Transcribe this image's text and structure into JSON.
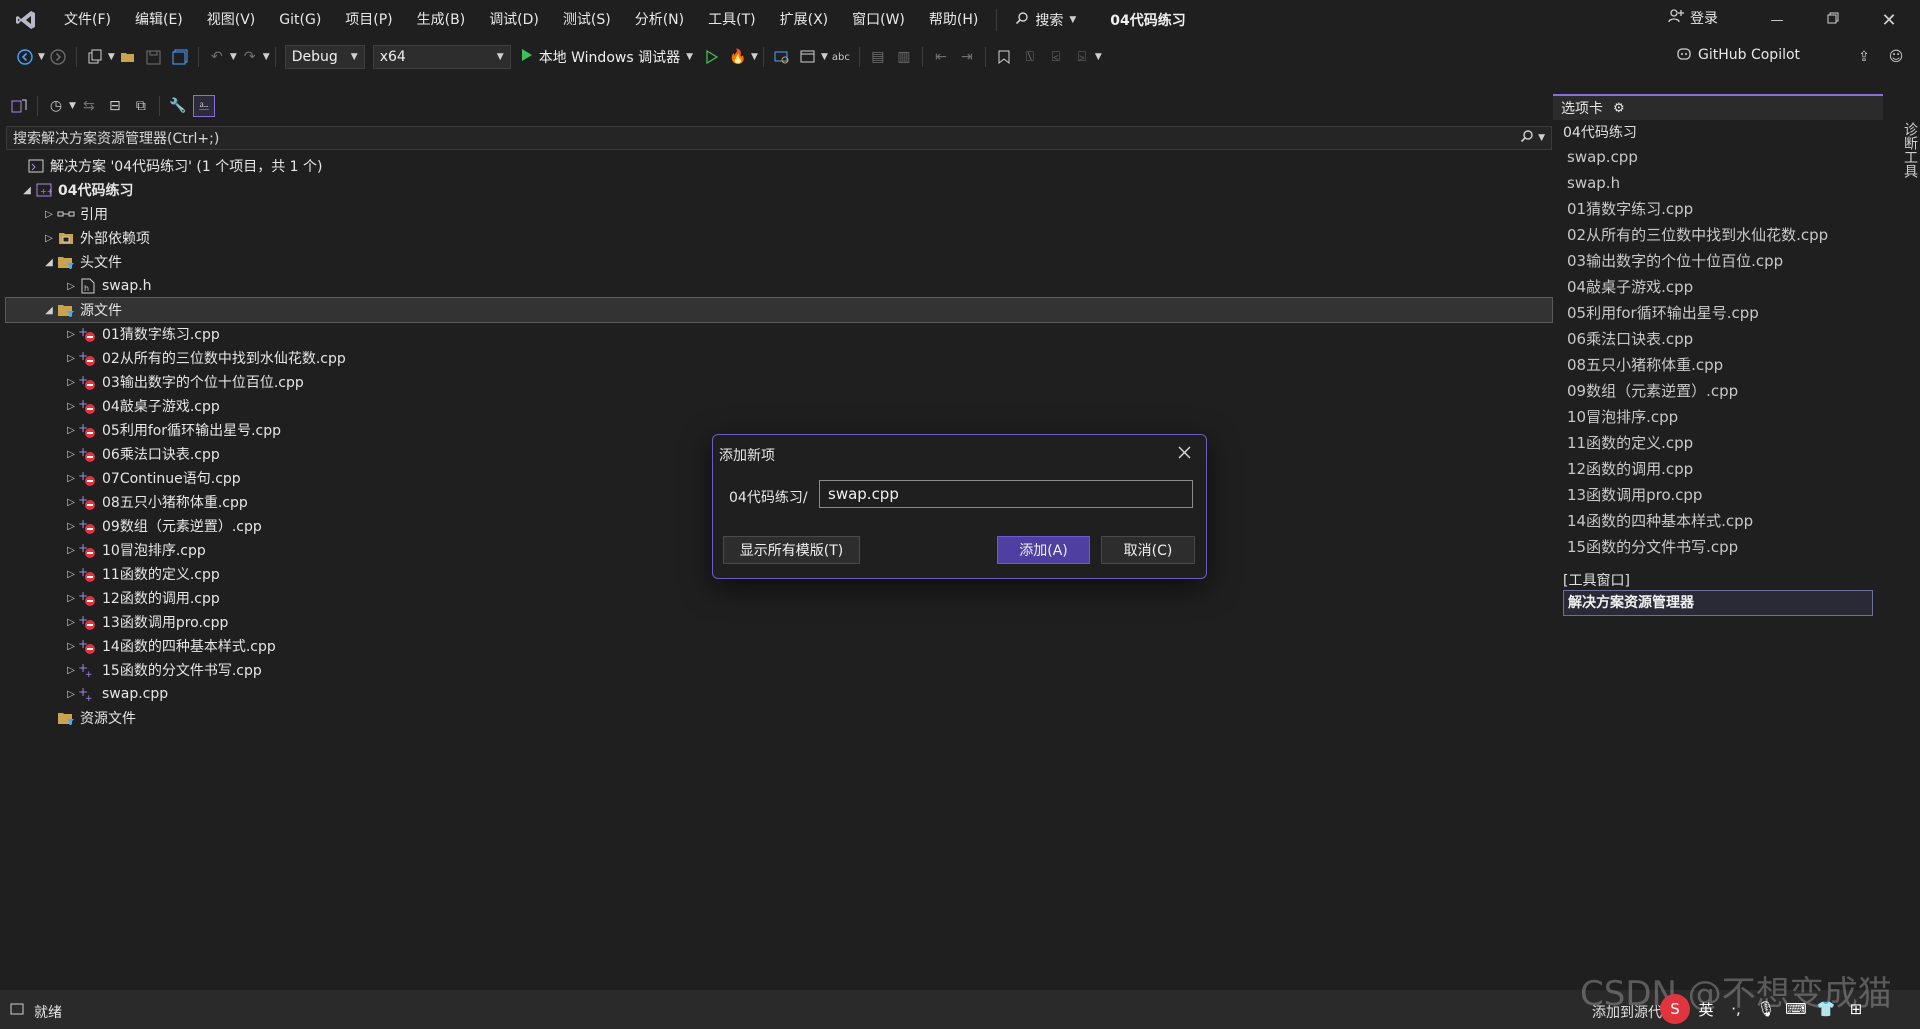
{
  "menubar": {
    "items": [
      "文件(F)",
      "编辑(E)",
      "视图(V)",
      "Git(G)",
      "项目(P)",
      "生成(B)",
      "调试(D)",
      "测试(S)",
      "分析(N)",
      "工具(T)",
      "扩展(X)",
      "窗口(W)",
      "帮助(H)"
    ],
    "search_label": "搜索",
    "solution_title": "04代码练习",
    "login_label": "登录"
  },
  "toolbar": {
    "config": "Debug",
    "platform": "x64",
    "run_label": "本地 Windows 调试器",
    "copilot_label": "GitHub Copilot"
  },
  "explorer": {
    "search_placeholder": "搜索解决方案资源管理器(Ctrl+;)",
    "solution_label": "解决方案 '04代码练习' (1 个项目，共 1 个)",
    "project_label": "04代码练习",
    "references_label": "引用",
    "external_deps_label": "外部依赖项",
    "header_files_label": "头文件",
    "header_files": [
      "swap.h"
    ],
    "source_files_label": "源文件",
    "source_files": [
      "01猜数字练习.cpp",
      "02从所有的三位数中找到水仙花数.cpp",
      "03输出数字的个位十位百位.cpp",
      "04敲桌子游戏.cpp",
      "05利用for循环输出星号.cpp",
      "06乘法口诀表.cpp",
      "07Continue语句.cpp",
      "08五只小猪称体重.cpp",
      "09数组（元素逆置）.cpp",
      "10冒泡排序.cpp",
      "11函数的定义.cpp",
      "12函数的调用.cpp",
      "13函数调用pro.cpp",
      "14函数的四种基本样式.cpp",
      "15函数的分文件书写.cpp",
      "swap.cpp"
    ],
    "resource_files_label": "资源文件"
  },
  "right_panel": {
    "header": "选项卡",
    "group_label": "04代码练习",
    "items": [
      "swap.cpp",
      "swap.h",
      "01猜数字练习.cpp",
      "02从所有的三位数中找到水仙花数.cpp",
      "03输出数字的个位十位百位.cpp",
      "04敲桌子游戏.cpp",
      "05利用for循环输出星号.cpp",
      "06乘法口诀表.cpp",
      "08五只小猪称体重.cpp",
      "09数组（元素逆置）.cpp",
      "10冒泡排序.cpp",
      "11函数的定义.cpp",
      "12函数的调用.cpp",
      "13函数调用pro.cpp",
      "14函数的四种基本样式.cpp",
      "15函数的分文件书写.cpp"
    ],
    "tools_label": "[工具窗口]",
    "solution_explorer_label": "解决方案资源管理器",
    "vertical_tab": "诊断工具"
  },
  "dialog": {
    "title": "添加新项",
    "path_label": "04代码练习/",
    "filename": "swap.cpp",
    "show_templates_label": "显示所有模版(T)",
    "add_label": "添加(A)",
    "cancel_label": "取消(C)"
  },
  "statusbar": {
    "status": "就绪",
    "add_to_source": "添加到源代",
    "watermark": "CSDN @不想变成猫"
  },
  "colors": {
    "accent": "#6b5bc4",
    "primary_button": "#4e3fa0",
    "error_badge": "#e0353f",
    "plus_badge": "#a887e8",
    "folder": "#c9a34e"
  }
}
